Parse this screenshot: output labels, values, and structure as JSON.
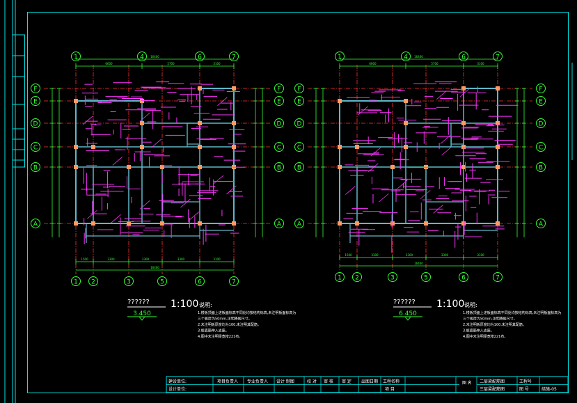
{
  "colors": {
    "background": "#000000",
    "frame": "#00e5e5",
    "axis_line": "#ff3333",
    "beam": "#5fb8c8",
    "annotation": "#ff33ff",
    "grid_bubble": "#33ff33",
    "column": "#ff9a66",
    "dimension": "#33ff33",
    "text": "#ffffff"
  },
  "sheets": [
    {
      "top_axes": [
        "1",
        "4",
        "6",
        "7"
      ],
      "bottom_axes": [
        "1",
        "2",
        "3",
        "5",
        "6",
        "7"
      ],
      "row_axes": [
        "F",
        "E",
        "D",
        "C",
        "B",
        "A"
      ],
      "overall_dim": "16400",
      "top_dims": [
        "6600",
        "5700",
        "3100"
      ],
      "bottom_dims": [
        "1500",
        "3300",
        "3300",
        "3300",
        "3100"
      ],
      "title": "??????",
      "scale": "1:100",
      "elevation": "3.450",
      "notes_title": "说明:",
      "notes": [
        "1.楼板顶面上述板面标高不同处均按结构标高,未注明板面标高为",
        "  三个板厚为50mm,注明降板尺寸。",
        "2.未注明板厚度均为100,未注明其配筋。",
        "3.板底筋伸入支座。",
        "4.图中未注明梁宽按221布。"
      ]
    },
    {
      "top_axes": [
        "1",
        "4",
        "6",
        "7"
      ],
      "bottom_axes": [
        "1",
        "2",
        "3",
        "5",
        "6",
        "7"
      ],
      "row_axes": [
        "F",
        "E",
        "D",
        "C",
        "B",
        "A"
      ],
      "overall_dim": "16400",
      "top_dims": [
        "6600",
        "5700",
        "3100"
      ],
      "bottom_dims": [
        "1500",
        "3300",
        "3300",
        "3300",
        "3100"
      ],
      "title": "??????",
      "scale": "1:100",
      "elevation": "6.450",
      "notes_title": "说明:",
      "notes": [
        "1.楼板顶面上述板面标高不同处均按结构标高,未注明板面标高为",
        "  三个板厚为50mm,注明降板尺寸。",
        "2.未注明板厚度均为100,未注明其配筋。",
        "3.板底筋伸入支座。",
        "4.图中未注明梁宽按221布。"
      ]
    }
  ],
  "title_block": {
    "approvals": [
      "建设单位:",
      "设计单位:"
    ],
    "roles": [
      "项目负责人",
      "专业负责人",
      "设计 制图",
      "校 对",
      "审 核",
      "审 定",
      "出图日期",
      "工程名称"
    ],
    "sub_item": "项 目",
    "drawing_label": "图 名",
    "drawing_names": [
      "二层梁配筋图",
      "三层梁配筋图"
    ],
    "project_no_label": "工程号",
    "sheet_no_label": "图 号",
    "sheet_no": "结施-05"
  }
}
